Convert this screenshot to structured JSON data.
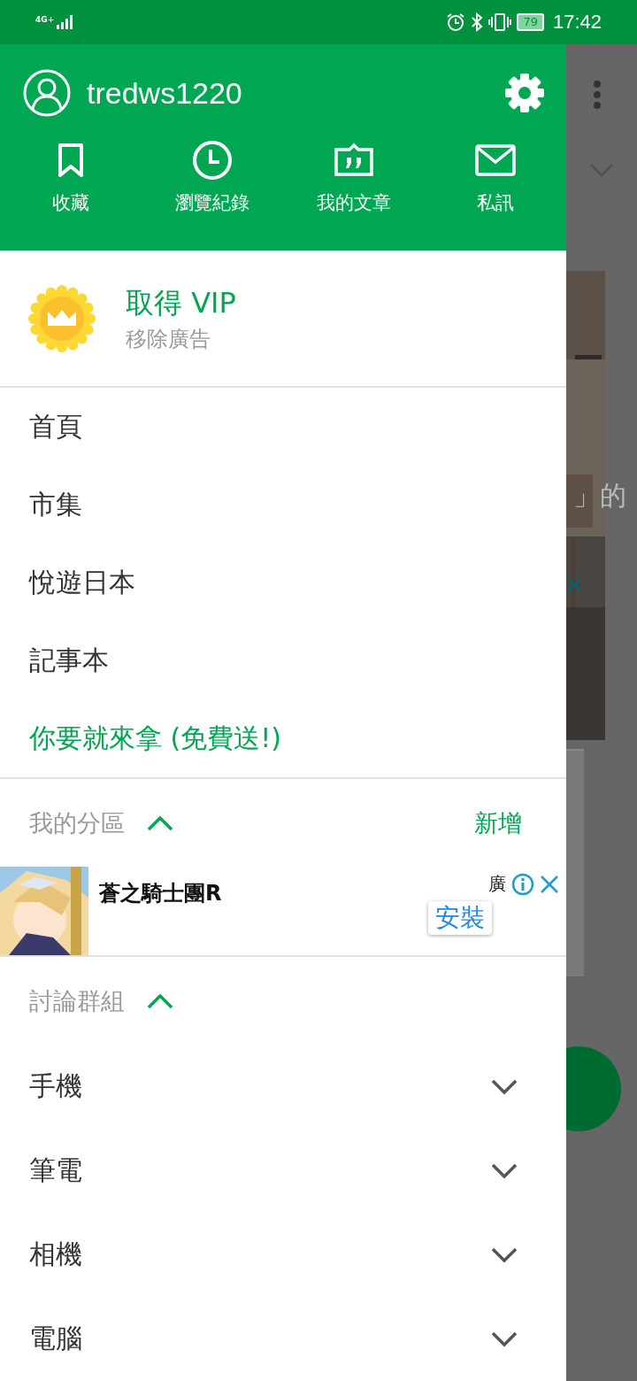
{
  "status_bar": {
    "network": "4G+",
    "battery": "79",
    "time": "17:42"
  },
  "drawer": {
    "username": "tredws1220",
    "shortcuts": [
      {
        "label": "收藏",
        "kind": "bookmark"
      },
      {
        "label": "瀏覽紀錄",
        "kind": "history"
      },
      {
        "label": "我的文章",
        "kind": "article"
      },
      {
        "label": "私訊",
        "kind": "mail"
      }
    ],
    "vip": {
      "title": "取得 VIP",
      "subtitle": "移除廣告"
    },
    "menu": [
      {
        "label": "首頁",
        "highlighted": false
      },
      {
        "label": "市集",
        "highlighted": false
      },
      {
        "label": "悅遊日本",
        "highlighted": false
      },
      {
        "label": "記事本",
        "highlighted": false
      },
      {
        "label": "你要就來拿 (免費送!)",
        "highlighted": true
      }
    ],
    "my_boards": {
      "title": "我的分區",
      "expanded": true,
      "action": "新增"
    },
    "ad": {
      "title": "蒼之騎士團R",
      "badge": "廣",
      "button": "安裝"
    },
    "groups": {
      "title": "討論群組",
      "expanded": true,
      "items": [
        {
          "label": "手機",
          "expanded": false
        },
        {
          "label": "筆電",
          "expanded": false
        },
        {
          "label": "相機",
          "expanded": false
        },
        {
          "label": "電腦",
          "expanded": false
        }
      ]
    }
  },
  "background": {
    "caption": "」的"
  }
}
